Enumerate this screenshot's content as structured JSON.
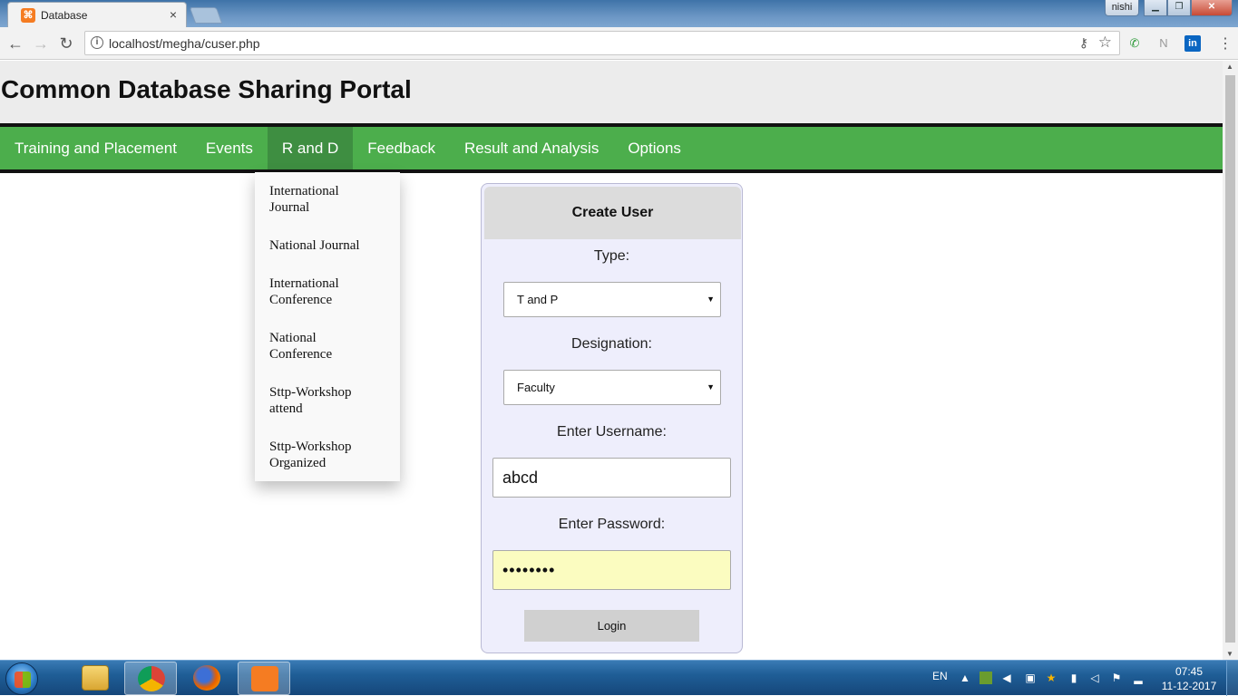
{
  "browser": {
    "tab_title": "Database",
    "tab_close": "×",
    "url": "localhost/megha/cuser.php",
    "profile_name": "nishi",
    "window_buttons": {
      "minimize": "▁",
      "maximize": "❐",
      "close": "✕"
    }
  },
  "page": {
    "title": "Common Database Sharing Portal",
    "nav": [
      {
        "label": "Training and Placement"
      },
      {
        "label": "Events"
      },
      {
        "label": "R and D",
        "active": true
      },
      {
        "label": "Feedback"
      },
      {
        "label": "Result and Analysis"
      },
      {
        "label": "Options"
      }
    ],
    "dropdown": [
      "International Journal",
      "National Journal",
      "International Conference",
      "National Conference",
      "Sttp-Workshop attend",
      "Sttp-Workshop Organized"
    ]
  },
  "form": {
    "heading": "Create User",
    "type_label": "Type:",
    "type_value": "T and P",
    "designation_label": "Designation:",
    "designation_value": "Faculty",
    "username_label": "Enter Username:",
    "username_value": "abcd",
    "password_label": "Enter Password:",
    "password_value": "••••••••",
    "submit_label": "Login"
  },
  "taskbar": {
    "language": "EN",
    "time": "07:45",
    "date": "11-12-2017"
  },
  "colors": {
    "navbar": "#4cae4c",
    "navbar_active": "#3e8e41",
    "card_bg": "#eeeefc",
    "password_bg": "#fbfcc0"
  }
}
